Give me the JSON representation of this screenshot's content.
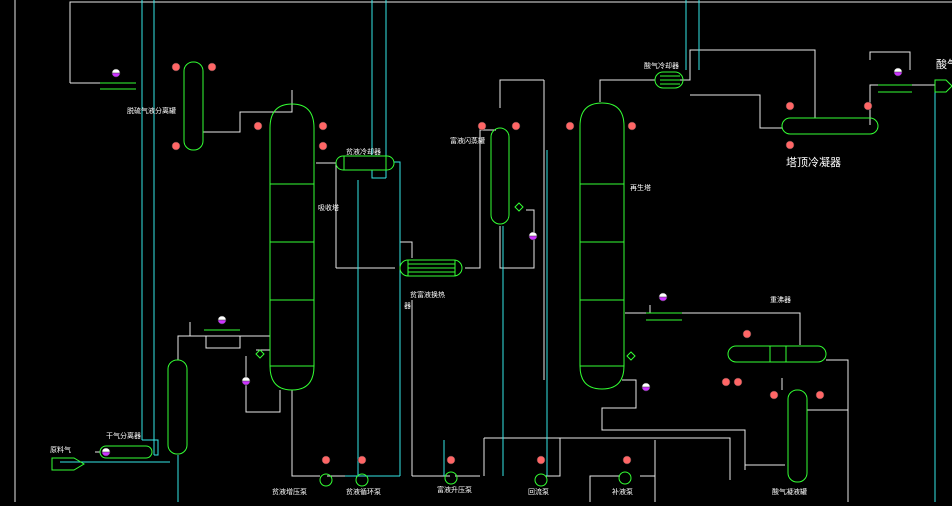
{
  "colors": {
    "background": "#000000",
    "equipment": "#33ff33",
    "pipe_main": "#e8e8e8",
    "pipe_cyan": "#33e6e6",
    "valve_red": "#ff6666",
    "valve_dark": "#333333",
    "sensor_purple": "#cc33ff",
    "sensor_face": "#ffffff"
  },
  "labels": {
    "knockout_drum": "脱硫气液分离罐",
    "absorber": "吸收塔",
    "lean_cooler": "贫液冷却器",
    "rich_flash_drum": "富液闪蒸罐",
    "regenerator": "再生塔",
    "acid_gas_cooler": "酸气冷却器",
    "overhead_condenser": "塔顶冷凝器",
    "acid_gas": "酸气",
    "lean_rich_exchanger_line1": "贫富液换热",
    "lean_rich_exchanger_line2": "器",
    "reboiler": "重沸器",
    "feed_gas": "原料气",
    "feed_separator": "干气分离器",
    "lean_booster_pump": "贫液增压泵",
    "lean_circ_pump": "贫液循环泵",
    "rich_pump": "富液升压泵",
    "reflux_pump": "回流泵",
    "makeup_pump": "补液泵",
    "condensate_drum": "酸气凝液罐"
  },
  "icons": {
    "valve": "red-valve-icon",
    "sensor": "pressure-sensor-icon",
    "pump": "centrifugal-pump-icon"
  }
}
